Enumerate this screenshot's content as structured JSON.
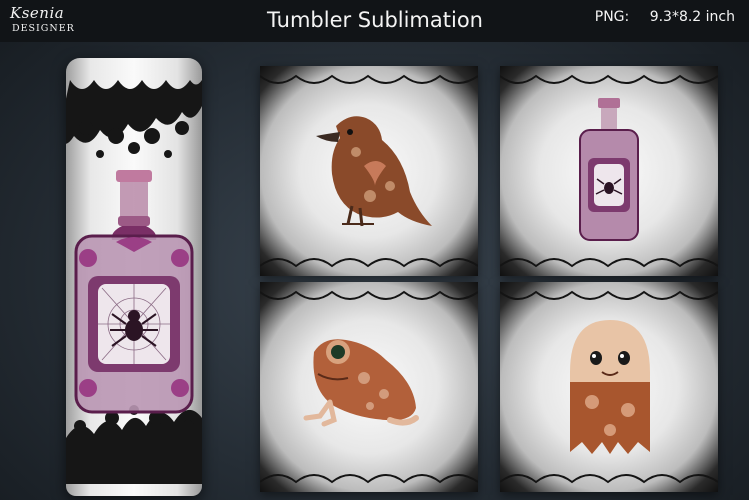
{
  "brand": {
    "name": "Ksenia",
    "sub": "DESIGNER"
  },
  "header": {
    "title": "Tumbler Sublimation",
    "format_label": "PNG:",
    "size_label": "9.3*8.2 inch"
  },
  "colors": {
    "topbar": "#111417",
    "background": "#252d35",
    "accent_purple": "#8a3d7a",
    "copper": "#a8562e",
    "lace": "#151515"
  },
  "products": {
    "tumbler": {
      "icon": "potion-bottle-spider-icon"
    },
    "tiles": [
      {
        "icon": "raven-icon"
      },
      {
        "icon": "potion-bottle-icon"
      },
      {
        "icon": "frog-icon"
      },
      {
        "icon": "ghost-icon"
      }
    ]
  }
}
